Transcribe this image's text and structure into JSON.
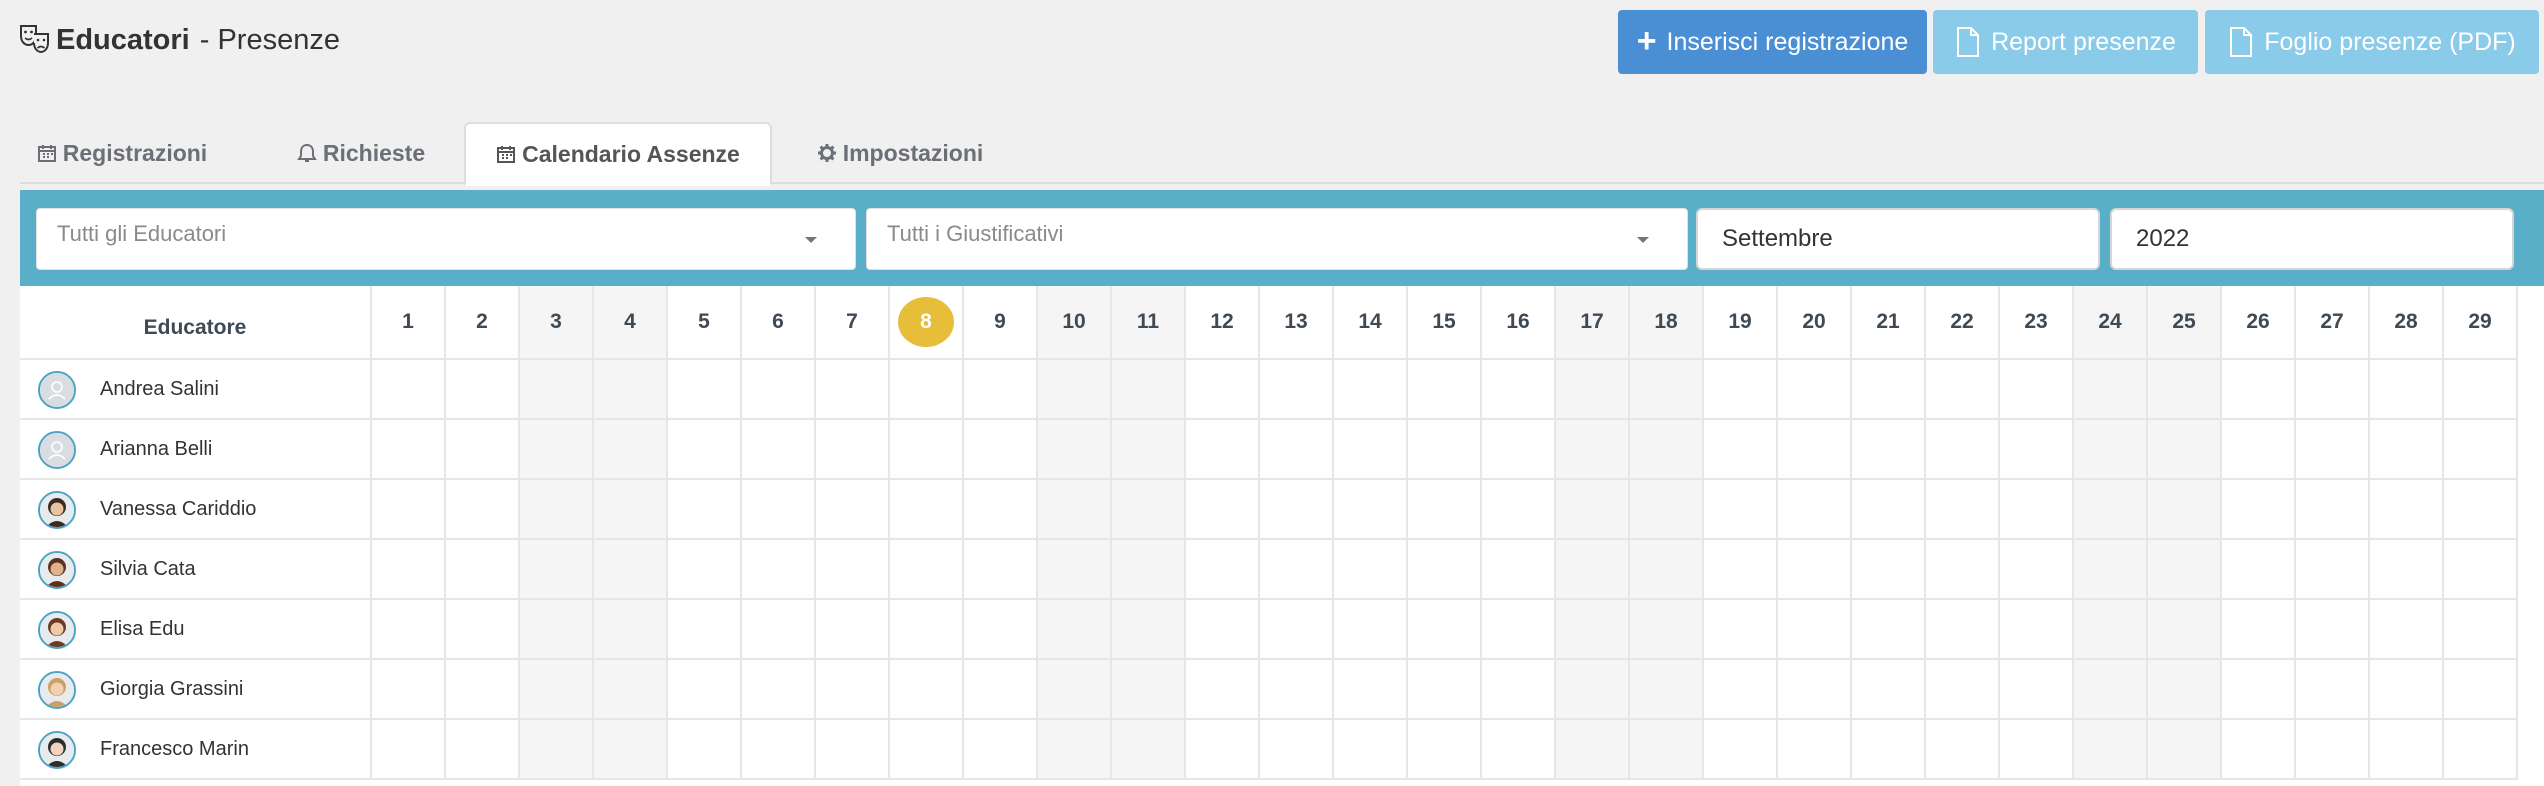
{
  "header": {
    "title_bold": "Educatori",
    "title_rest": "- Presenze",
    "title_icon": "theater-masks-icon"
  },
  "actions": {
    "insert_label": "Inserisci registrazione",
    "report_label": "Report presenze",
    "sheet_label": "Foglio presenze (PDF)"
  },
  "tabs": [
    {
      "label": "Registrazioni",
      "icon": "calendar-icon"
    },
    {
      "label": "Richieste",
      "icon": "bell-icon"
    },
    {
      "label": "Calendario Assenze",
      "icon": "calendar-icon",
      "active": true
    },
    {
      "label": "Impostazioni",
      "icon": "gear-icon"
    }
  ],
  "filters": {
    "educators_placeholder": "Tutti gli Educatori",
    "justifications_placeholder": "Tutti i Giustificativi",
    "month": "Settembre",
    "year": "2022"
  },
  "calendar": {
    "name_header": "Educatore",
    "days": [
      "1",
      "2",
      "3",
      "4",
      "5",
      "6",
      "7",
      "8",
      "9",
      "10",
      "11",
      "12",
      "13",
      "14",
      "15",
      "16",
      "17",
      "18",
      "19",
      "20",
      "21",
      "22",
      "23",
      "24",
      "25",
      "26",
      "27",
      "28",
      "29"
    ],
    "today": "8",
    "weekend_days": [
      "3",
      "4",
      "10",
      "11",
      "17",
      "18",
      "24",
      "25"
    ],
    "educators": [
      {
        "name": "Andrea Salini"
      },
      {
        "name": "Arianna Belli"
      },
      {
        "name": "Vanessa Cariddio"
      },
      {
        "name": "Silvia Cata"
      },
      {
        "name": "Elisa Edu"
      },
      {
        "name": "Giorgia Grassini"
      },
      {
        "name": "Francesco Marin"
      }
    ]
  },
  "colors": {
    "primary": "#4a8fd4",
    "info": "#89cbe8",
    "filterbar": "#5aafc8",
    "today": "#e6be3a",
    "avatar_ring": "#4ba3c4"
  }
}
